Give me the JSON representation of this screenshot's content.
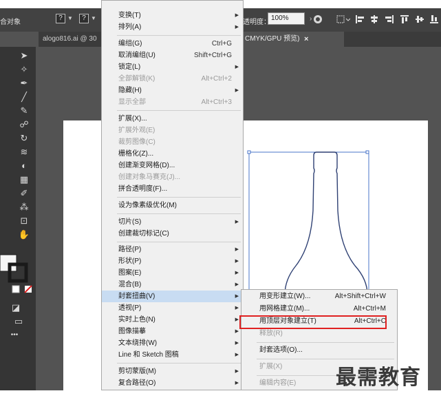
{
  "control_bar": {
    "label": "合对象",
    "box1": "?",
    "box2": "?",
    "opacity_label": "透明度：",
    "opacity_value": "100%",
    "opacity_arrow": "›"
  },
  "tabs": [
    {
      "label": "alogo816.ai @ 30"
    },
    {
      "label": "CMYK/GPU 预览)"
    }
  ],
  "tab_close": "×",
  "menu": {
    "items": [
      {
        "label": "变换(T)",
        "shortcut": "",
        "submenu": true,
        "disabled": false
      },
      {
        "label": "排列(A)",
        "shortcut": "",
        "submenu": true,
        "disabled": false
      },
      {
        "label": "编组(G)",
        "shortcut": "Ctrl+G",
        "submenu": false,
        "disabled": false
      },
      {
        "label": "取消编组(U)",
        "shortcut": "Shift+Ctrl+G",
        "submenu": false,
        "disabled": false
      },
      {
        "label": "锁定(L)",
        "shortcut": "",
        "submenu": true,
        "disabled": false
      },
      {
        "label": "全部解锁(K)",
        "shortcut": "Alt+Ctrl+2",
        "submenu": false,
        "disabled": true
      },
      {
        "label": "隐藏(H)",
        "shortcut": "",
        "submenu": true,
        "disabled": false
      },
      {
        "label": "显示全部",
        "shortcut": "Alt+Ctrl+3",
        "submenu": false,
        "disabled": true
      },
      {
        "label": "扩展(X)...",
        "shortcut": "",
        "submenu": false,
        "disabled": false
      },
      {
        "label": "扩展外观(E)",
        "shortcut": "",
        "submenu": false,
        "disabled": true
      },
      {
        "label": "裁剪图像(C)",
        "shortcut": "",
        "submenu": false,
        "disabled": true
      },
      {
        "label": "栅格化(Z)...",
        "shortcut": "",
        "submenu": false,
        "disabled": false
      },
      {
        "label": "创建渐变网格(D)...",
        "shortcut": "",
        "submenu": false,
        "disabled": false
      },
      {
        "label": "创建对象马赛克(J)...",
        "shortcut": "",
        "submenu": false,
        "disabled": true
      },
      {
        "label": "拼合透明度(F)...",
        "shortcut": "",
        "submenu": false,
        "disabled": false
      },
      {
        "label": "设为像素级优化(M)",
        "shortcut": "",
        "submenu": false,
        "disabled": false
      },
      {
        "label": "切片(S)",
        "shortcut": "",
        "submenu": true,
        "disabled": false
      },
      {
        "label": "创建裁切标记(C)",
        "shortcut": "",
        "submenu": false,
        "disabled": false
      },
      {
        "label": "路径(P)",
        "shortcut": "",
        "submenu": true,
        "disabled": false
      },
      {
        "label": "形状(P)",
        "shortcut": "",
        "submenu": true,
        "disabled": false
      },
      {
        "label": "图案(E)",
        "shortcut": "",
        "submenu": true,
        "disabled": false
      },
      {
        "label": "混合(B)",
        "shortcut": "",
        "submenu": true,
        "disabled": false
      },
      {
        "label": "封套扭曲(V)",
        "shortcut": "",
        "submenu": true,
        "disabled": false,
        "highlighted": true
      },
      {
        "label": "透视(P)",
        "shortcut": "",
        "submenu": true,
        "disabled": false
      },
      {
        "label": "实时上色(N)",
        "shortcut": "",
        "submenu": true,
        "disabled": false
      },
      {
        "label": "图像描摹",
        "shortcut": "",
        "submenu": true,
        "disabled": false
      },
      {
        "label": "文本绕排(W)",
        "shortcut": "",
        "submenu": true,
        "disabled": false
      },
      {
        "label": "Line 和 Sketch 图稿",
        "shortcut": "",
        "submenu": true,
        "disabled": false
      },
      {
        "label": "剪切蒙版(M)",
        "shortcut": "",
        "submenu": true,
        "disabled": false
      },
      {
        "label": "复合路径(O)",
        "shortcut": "",
        "submenu": true,
        "disabled": false
      }
    ]
  },
  "submenu": {
    "items": [
      {
        "label": "用变形建立(W)...",
        "shortcut": "Alt+Shift+Ctrl+W",
        "disabled": false
      },
      {
        "label": "用网格建立(M)...",
        "shortcut": "Alt+Ctrl+M",
        "disabled": false
      },
      {
        "label": "用顶层对象建立(T)",
        "shortcut": "Alt+Ctrl+C",
        "disabled": false,
        "boxed": true
      },
      {
        "label": "释放(R)",
        "shortcut": "",
        "disabled": true
      },
      {
        "label": "封套选项(O)...",
        "shortcut": "",
        "disabled": false
      },
      {
        "label": "扩展(X)",
        "shortcut": "",
        "disabled": true
      },
      {
        "label": "编辑内容(E)",
        "shortcut": "",
        "disabled": true
      }
    ]
  },
  "watermark": "最需教育",
  "colors": {
    "accent_red": "#e02020",
    "selection_blue": "#4a74c9",
    "menu_highlight": "#c8dcf2"
  }
}
